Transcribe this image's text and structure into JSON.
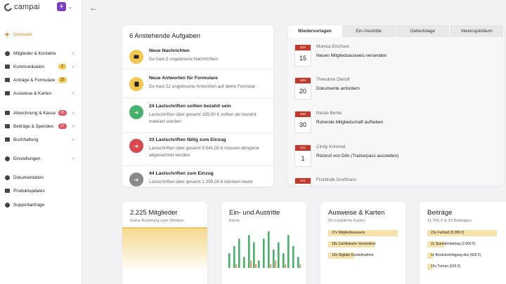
{
  "app": {
    "name": "campai",
    "org_initial": "⚘"
  },
  "sidebar": {
    "items": [
      {
        "label": "Startseite",
        "icon": "sun-icon"
      },
      {
        "label": "Mitglieder & Kontakte",
        "icon": "people-icon"
      },
      {
        "label": "Kommunikation",
        "icon": "chat-icon",
        "badge": "2"
      },
      {
        "label": "Anträge & Formulare",
        "icon": "form-icon",
        "badge": "22"
      },
      {
        "label": "Ausweise & Karten",
        "icon": "card-icon"
      },
      {
        "label": "Abrechnung & Kasse",
        "icon": "billing-icon",
        "badge": "33"
      },
      {
        "label": "Beiträge & Spenden",
        "icon": "donation-icon",
        "badge": "12"
      },
      {
        "label": "Buchhaltung",
        "icon": "ledger-icon"
      },
      {
        "label": "Einstellungen",
        "icon": "gear-icon"
      },
      {
        "label": "Dokumentation",
        "icon": "docs-icon"
      },
      {
        "label": "Produktupdates",
        "icon": "gift-icon"
      },
      {
        "label": "Supportanfrage",
        "icon": "support-icon"
      }
    ]
  },
  "tasks": {
    "title": "6 Anstehende Aufgaben",
    "items": [
      {
        "title": "Neue Nachrichten",
        "text": "Du hast 2 ungelesene Nachrichten",
        "color": "#f3c74d",
        "icon": "message-icon"
      },
      {
        "title": "Neue Antworten für Formulare",
        "text": "Du hast 22 ungelesene Antworten auf deine Formular",
        "color": "#f3c74d",
        "icon": "form-icon"
      },
      {
        "title": "24 Lastschriften sollten bezahlt sein",
        "text": "Lastschriften über gesamt 165,00 € sollten als bezahlt markiert werden",
        "color": "#45b26b",
        "icon": "arrow-icon"
      },
      {
        "title": "33 Lastschriften fällig zum Einzug",
        "text": "Lastschriften über gesamt 9.541,00 € müssen dringend abgerechnet werden",
        "color": "#d9484f",
        "icon": "arrow-icon"
      },
      {
        "title": "44 Lastschriften zum Einzug",
        "text": "Lastschriften über gesamt 1.290,00 € könnten heute",
        "color": "#8a8a8a",
        "icon": "arrow-icon"
      }
    ]
  },
  "feed": {
    "tabs": [
      "Wiedervorlagen",
      "Ein-/Austritte",
      "Geburtstage",
      "Vereinsjubiläum"
    ],
    "entries": [
      {
        "month": "JUN",
        "day": "15",
        "name": "Monica Erichsen",
        "text": "Neuen Mitgliedsausweis versenden"
      },
      {
        "month": "JUN",
        "day": "20",
        "name": "Theodore Dierolf",
        "text": "Dokumente anfordern"
      },
      {
        "month": "JUN",
        "day": "30",
        "name": "Nicole Bente",
        "text": "Ruhende Mitgliedschaft aufheben"
      },
      {
        "month": "JUL",
        "day": "1",
        "name": "Cindy Krimmel",
        "text": "Rückruf von Dirk (Trainerpass ausstellen)"
      },
      {
        "month": "JUL",
        "day": "",
        "name": "Frohlinde Großhans",
        "text": ""
      }
    ]
  },
  "stats": {
    "members": {
      "title": "2.225 Mitglieder",
      "sub": "Keine Änderung zum Oktober"
    },
    "inout": {
      "title": "Ein- und Austritte",
      "sub": "Keine"
    },
    "cards": {
      "title": "Ausweise & Karten",
      "sub": "55 installierte Karten",
      "bars": [
        {
          "label": "27x Mitgliedsausweis",
          "value": 27
        },
        {
          "label": "18x Zutrittskarte Vereinsfest",
          "value": 18
        },
        {
          "label": "10x Digitale Kursteilnahme",
          "value": 10
        }
      ]
    },
    "fees": {
      "title": "Beiträge",
      "sub": "11.705 € in 53 Beiträgen",
      "bars": [
        {
          "label": "23x Fußball (8.280 €)",
          "value": 8280
        },
        {
          "label": "2x Spendenbeitrag (2.000 €)",
          "value": 2000
        },
        {
          "label": "1x Berücksichtigung des (600 €)",
          "value": 600
        },
        {
          "label": "15x Turnen (525 €)",
          "value": 525
        }
      ]
    }
  },
  "inout_chart": {
    "entries": [
      4,
      6,
      8,
      3,
      9,
      7,
      2,
      8,
      10,
      5,
      7,
      4,
      9,
      6,
      3
    ],
    "exits": [
      0,
      1,
      0,
      0,
      2,
      1,
      0,
      0,
      1,
      2,
      0,
      1,
      0,
      0,
      1
    ],
    "color_entries": "#45b26b",
    "color_exits": "#d9a06b"
  }
}
